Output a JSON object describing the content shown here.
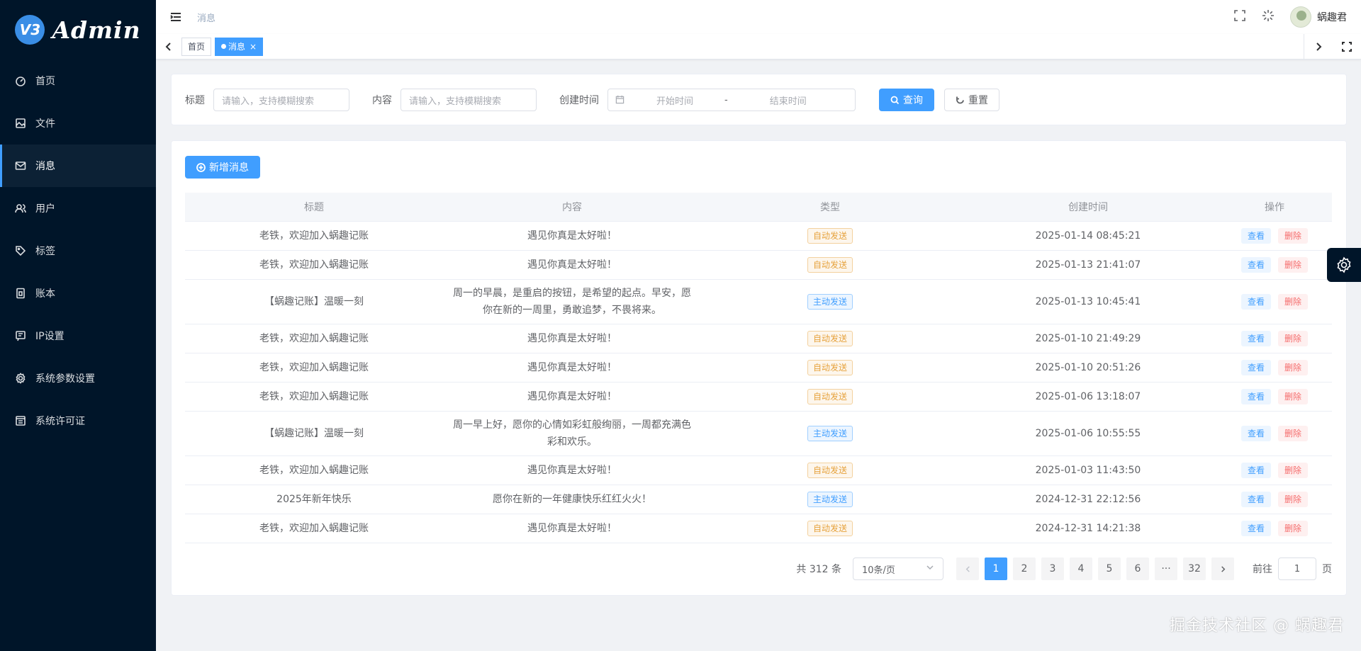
{
  "app": {
    "logo_badge": "V3",
    "logo_text": "Admin"
  },
  "sidebar": {
    "items": [
      {
        "label": "首页",
        "icon": "dashboard-icon"
      },
      {
        "label": "文件",
        "icon": "file-image-icon"
      },
      {
        "label": "消息",
        "icon": "mail-icon",
        "active": true
      },
      {
        "label": "用户",
        "icon": "user-group-icon"
      },
      {
        "label": "标签",
        "icon": "tag-icon"
      },
      {
        "label": "账本",
        "icon": "book-icon"
      },
      {
        "label": "IP设置",
        "icon": "ip-icon"
      },
      {
        "label": "系统参数设置",
        "icon": "gear-icon"
      },
      {
        "label": "系统许可证",
        "icon": "license-icon"
      }
    ]
  },
  "header": {
    "breadcrumb": "消息",
    "username": "蜗趣君"
  },
  "tags": {
    "home": "首页",
    "current": "消息"
  },
  "search": {
    "title_label": "标题",
    "title_placeholder": "请输入，支持模糊搜索",
    "content_label": "内容",
    "content_placeholder": "请输入，支持模糊搜索",
    "created_label": "创建时间",
    "start_placeholder": "开始时间",
    "range_sep": "-",
    "end_placeholder": "结束时间",
    "query_button": "查询",
    "reset_button": "重置"
  },
  "toolbar": {
    "add_button": "新增消息"
  },
  "table": {
    "columns": [
      "标题",
      "内容",
      "类型",
      "创建时间",
      "操作"
    ],
    "view_label": "查看",
    "delete_label": "删除",
    "rows": [
      {
        "title": "老铁，欢迎加入蜗趣记账",
        "content": "遇见你真是太好啦！",
        "type": "自动发送",
        "kind": "auto",
        "created": "2025-01-14 08:45:21"
      },
      {
        "title": "老铁，欢迎加入蜗趣记账",
        "content": "遇见你真是太好啦！",
        "type": "自动发送",
        "kind": "auto",
        "created": "2025-01-13 21:41:07"
      },
      {
        "title": "【蜗趣记账】温暖一刻",
        "content": "周一的早晨，是重启的按钮，是希望的起点。早安，愿你在新的一周里，勇敢追梦，不畏将来。",
        "type": "主动发送",
        "kind": "active",
        "created": "2025-01-13 10:45:41"
      },
      {
        "title": "老铁，欢迎加入蜗趣记账",
        "content": "遇见你真是太好啦！",
        "type": "自动发送",
        "kind": "auto",
        "created": "2025-01-10 21:49:29"
      },
      {
        "title": "老铁，欢迎加入蜗趣记账",
        "content": "遇见你真是太好啦！",
        "type": "自动发送",
        "kind": "auto",
        "created": "2025-01-10 20:51:26"
      },
      {
        "title": "老铁，欢迎加入蜗趣记账",
        "content": "遇见你真是太好啦！",
        "type": "自动发送",
        "kind": "auto",
        "created": "2025-01-06 13:18:07"
      },
      {
        "title": "【蜗趣记账】温暖一刻",
        "content": "周一早上好，愿你的心情如彩虹般绚丽，一周都充满色彩和欢乐。",
        "type": "主动发送",
        "kind": "active",
        "created": "2025-01-06 10:55:55"
      },
      {
        "title": "老铁，欢迎加入蜗趣记账",
        "content": "遇见你真是太好啦！",
        "type": "自动发送",
        "kind": "auto",
        "created": "2025-01-03 11:43:50"
      },
      {
        "title": "2025年新年快乐",
        "content": "愿你在新的一年健康快乐红红火火！",
        "type": "主动发送",
        "kind": "active",
        "created": "2024-12-31 22:12:56"
      },
      {
        "title": "老铁，欢迎加入蜗趣记账",
        "content": "遇见你真是太好啦！",
        "type": "自动发送",
        "kind": "auto",
        "created": "2024-12-31 14:21:38"
      }
    ]
  },
  "pagination": {
    "total": "共 312 条",
    "page_size": "10条/页",
    "pages": [
      "1",
      "2",
      "3",
      "4",
      "5",
      "6",
      "···",
      "32"
    ],
    "current": "1",
    "goto_label": "前往",
    "goto_value": "1",
    "page_suffix": "页"
  },
  "watermark": "掘金技术社区 @ 蜗趣君",
  "colors": {
    "sidebar_bg": "#001529",
    "primary": "#409eff",
    "auto_tag": "#e6a23c",
    "danger": "#f56c6c"
  }
}
